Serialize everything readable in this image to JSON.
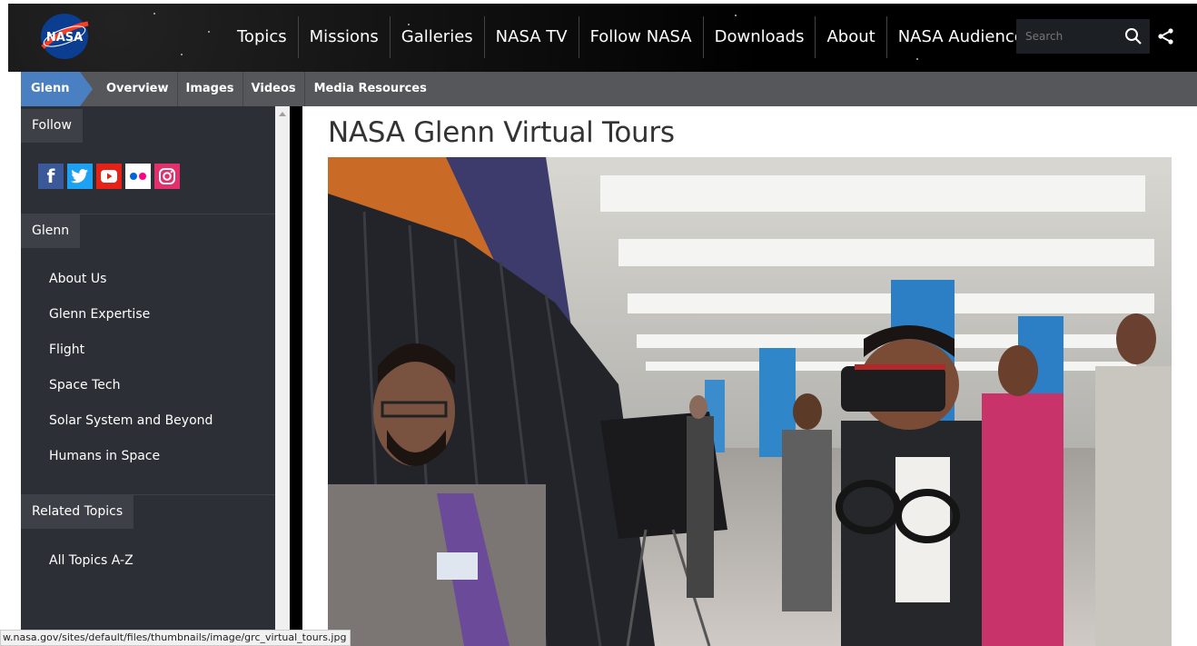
{
  "logo": {
    "text": "NASA"
  },
  "topnav": {
    "items": [
      "Topics",
      "Missions",
      "Galleries",
      "NASA TV",
      "Follow NASA",
      "Downloads",
      "About",
      "NASA Audiences"
    ],
    "search_placeholder": "Search"
  },
  "subnav": {
    "current": "Glenn",
    "items": [
      "Overview",
      "Images",
      "Videos",
      "Media Resources"
    ]
  },
  "sidebar": {
    "follow_heading": "Follow",
    "social": [
      "facebook-icon",
      "twitter-icon",
      "youtube-icon",
      "flickr-icon",
      "instagram-icon"
    ],
    "glenn_heading": "Glenn",
    "links": [
      "About Us",
      "Glenn Expertise",
      "Flight",
      "Space Tech",
      "Solar System and Beyond",
      "Humans in Space"
    ],
    "related_heading": "Related Topics",
    "related_links": [
      "All Topics A-Z"
    ]
  },
  "main": {
    "title": "NASA Glenn Virtual Tours"
  },
  "statusbar": {
    "url": "w.nasa.gov/sites/default/files/thumbnails/image/grc_virtual_tours.jpg"
  },
  "colors": {
    "subnav_active": "#4a80c2",
    "sidebar_bg": "#2d2f36",
    "subnav_bg": "#56575a"
  }
}
